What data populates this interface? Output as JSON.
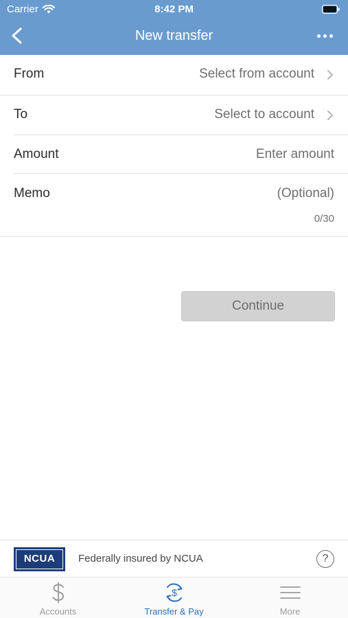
{
  "status_bar": {
    "carrier": "Carrier",
    "time": "8:42 PM"
  },
  "navbar": {
    "title": "New transfer"
  },
  "form": {
    "from": {
      "label": "From",
      "value": "Select from account"
    },
    "to": {
      "label": "To",
      "value": "Select to account"
    },
    "amount": {
      "label": "Amount",
      "placeholder": "Enter amount"
    },
    "memo": {
      "label": "Memo",
      "placeholder": "(Optional)",
      "counter": "0/30"
    }
  },
  "continue_label": "Continue",
  "insurance": {
    "logo_text": "NCUA",
    "text": "Federally insured by NCUA",
    "help_symbol": "?"
  },
  "tabs": [
    {
      "label": "Accounts",
      "icon": "dollar-icon",
      "active": false
    },
    {
      "label": "Transfer & Pay",
      "icon": "transfer-pay-icon",
      "active": true
    },
    {
      "label": "More",
      "icon": "menu-icon",
      "active": false
    }
  ],
  "colors": {
    "header": "#6a9bcf",
    "active_tab": "#2e6fb8",
    "button_disabled": "#d2d2d2"
  }
}
